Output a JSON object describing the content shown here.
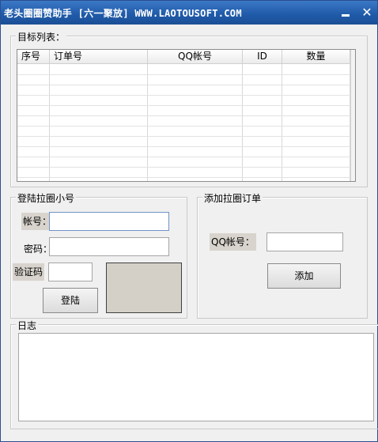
{
  "window": {
    "title": "老头圈圈赞助手 [六一聚放] WWW.LAOTOUSOFT.COM",
    "minimize": "–",
    "close": "✕"
  },
  "targets": {
    "legend": "目标列表：",
    "columns": [
      "序号",
      "订单号",
      "QQ帐号",
      "ID",
      "数量"
    ],
    "rows": []
  },
  "login": {
    "legend": "登陆拉圈小号",
    "account_label": "帐号：",
    "account_value": "",
    "password_label": "密码：",
    "password_value": "",
    "captcha_label": "验证码",
    "captcha_value": "",
    "login_button": "登陆"
  },
  "add_order": {
    "legend": "添加拉圈订单",
    "qq_label": "QQ帐号：",
    "qq_value": "",
    "add_button": "添加"
  },
  "log": {
    "legend": "日志",
    "content": ""
  }
}
